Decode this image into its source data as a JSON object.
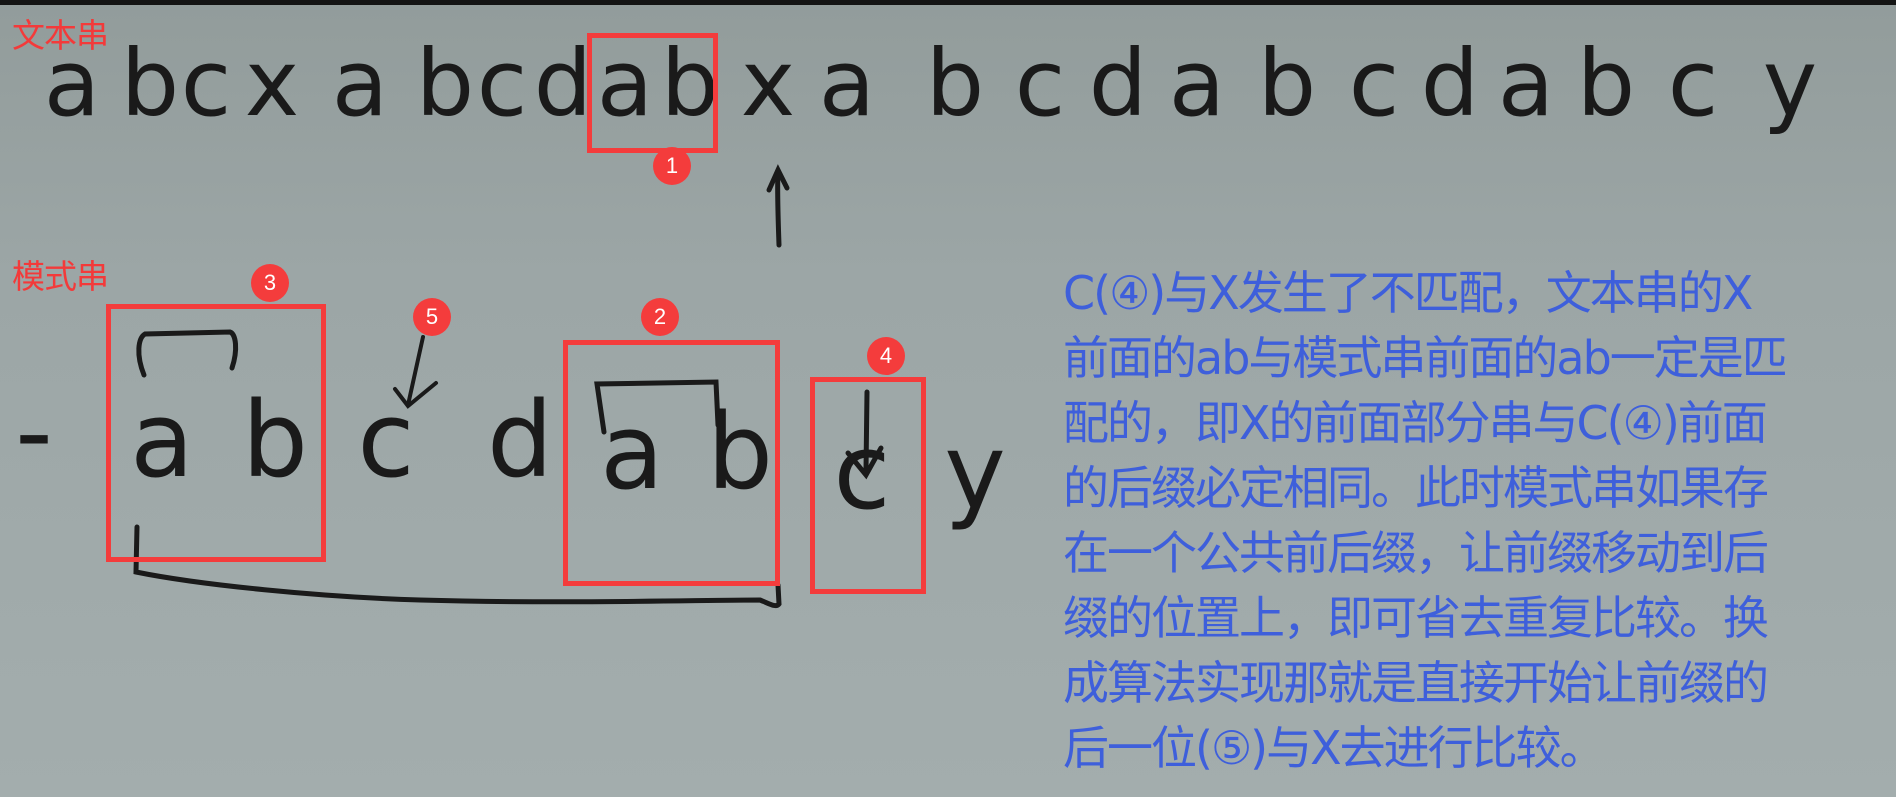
{
  "labels": {
    "text_string": "文本串",
    "pattern_string": "模式串"
  },
  "text_row": {
    "letters": [
      "a",
      "b",
      "c",
      "x",
      "a",
      "b",
      "c",
      "d",
      "a",
      "b",
      "x",
      "a",
      "b",
      "c",
      "d",
      "a",
      "b",
      "c",
      "d",
      "a",
      "b",
      "c",
      "y"
    ]
  },
  "pattern_row": {
    "leading_dash": "-",
    "letters": [
      "a",
      "b",
      "c",
      "d",
      "a",
      "b",
      "c",
      "y"
    ]
  },
  "badges": {
    "b1": "1",
    "b2": "2",
    "b3": "3",
    "b4": "4",
    "b5": "5"
  },
  "explanation": {
    "lines": [
      "C(④)与X发生了不匹配，文本串的X",
      "前面的ab与模式串前面的ab一定是匹",
      "配的，即X的前面部分串与C(④)前面",
      "的后缀必定相同。此时模式串如果存",
      "在一个公共前后缀，让前缀移动到后",
      "缀的位置上，即可省去重复比较。换",
      "成算法实现那就是直接开始让前缀的",
      "后一位(⑤)与X去进行比较。"
    ]
  },
  "colors": {
    "annotation_red": "#f43c3c",
    "explanation_blue": "#3e5fdb",
    "ink": "#1a1a1a",
    "board": "#9ca6a6"
  }
}
